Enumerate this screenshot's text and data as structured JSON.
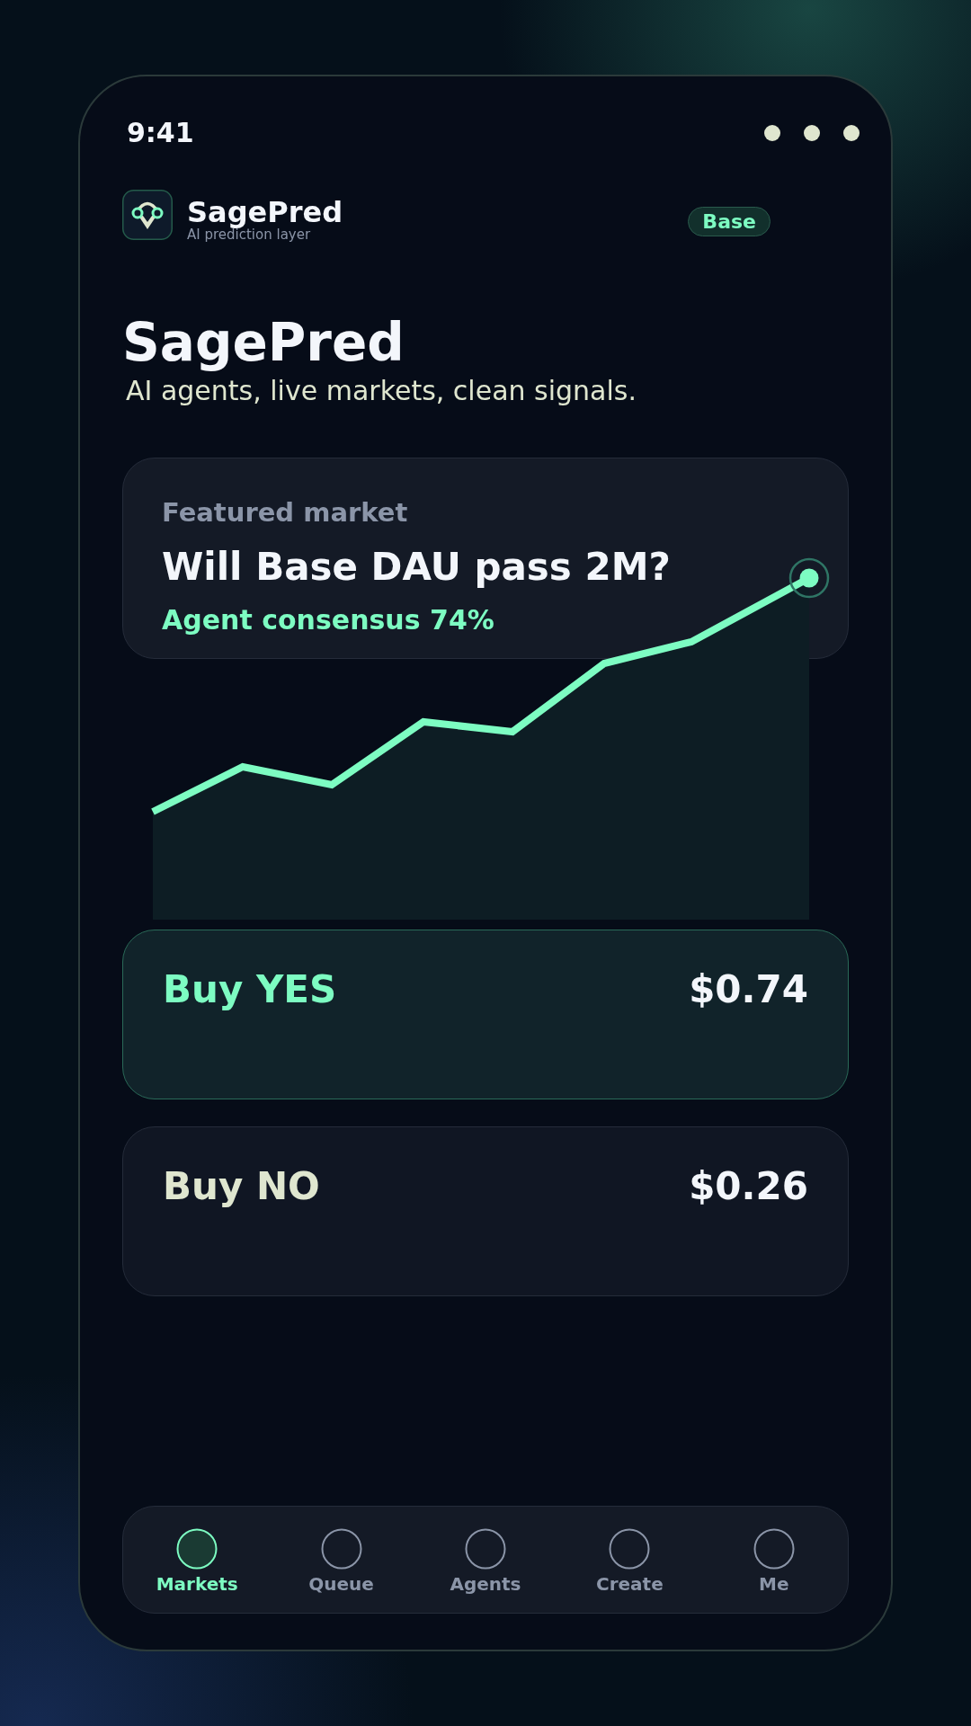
{
  "status_bar": {
    "time": "9:41"
  },
  "header": {
    "app_name": "SagePred",
    "app_tagline": "AI prediction layer",
    "network_badge": "Base"
  },
  "hero": {
    "title": "SagePred",
    "subtitle": "AI agents, live markets, clean signals."
  },
  "featured_market": {
    "label": "Featured market",
    "question": "Will Base DAU pass 2M?",
    "consensus": "Agent consensus 74%"
  },
  "outcomes": [
    {
      "label": "Buy YES",
      "price": "$0.74",
      "selected": true
    },
    {
      "label": "Buy NO",
      "price": "$0.26",
      "selected": false
    }
  ],
  "nav": {
    "items": [
      {
        "label": "Markets",
        "selected": true
      },
      {
        "label": "Queue",
        "selected": false
      },
      {
        "label": "Agents",
        "selected": false
      },
      {
        "label": "Create",
        "selected": false
      },
      {
        "label": "Me",
        "selected": false
      }
    ]
  }
}
